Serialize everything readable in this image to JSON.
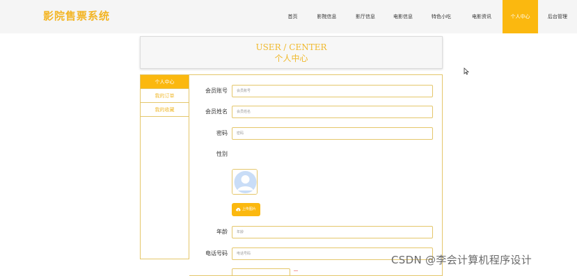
{
  "app": {
    "title": "影院售票系统"
  },
  "nav": {
    "items": [
      {
        "label": "首页",
        "active": false
      },
      {
        "label": "影院信息",
        "active": false
      },
      {
        "label": "影厅信息",
        "active": false
      },
      {
        "label": "电影信息",
        "active": false
      },
      {
        "label": "特色小吃",
        "active": false
      },
      {
        "label": "电影资讯",
        "active": false
      },
      {
        "label": "个人中心",
        "active": true
      },
      {
        "label": "后台管理",
        "active": false
      }
    ]
  },
  "page_header": {
    "title_en": "USER / CENTER",
    "title_cn": "个人中心"
  },
  "sidebar": {
    "items": [
      {
        "label": "个人中心",
        "active": true
      },
      {
        "label": "我的订单",
        "active": false
      },
      {
        "label": "我的收藏",
        "active": false
      }
    ]
  },
  "form": {
    "account": {
      "label": "会员账号",
      "placeholder": "会员账号"
    },
    "name": {
      "label": "会员姓名",
      "placeholder": "会员姓名"
    },
    "password": {
      "label": "密码",
      "placeholder": "密码"
    },
    "gender": {
      "label": "性别"
    },
    "upload": {
      "label": "上传图片",
      "icon": "cloud-upload-icon"
    },
    "age": {
      "label": "年龄",
      "placeholder": "年龄"
    },
    "phone": {
      "label": "电话号码",
      "placeholder": "电话号码"
    }
  },
  "colors": {
    "accent": "#fbb80f",
    "brand_text": "#f3b525",
    "border": "#e4c66a",
    "topbar_bg": "#f5f5f5"
  },
  "watermark": "CSDN @李会计算机程序设计"
}
